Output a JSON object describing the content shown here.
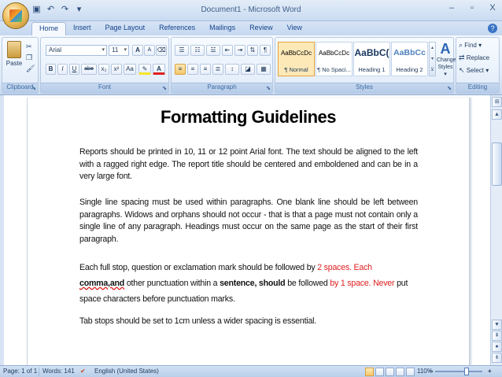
{
  "window": {
    "title": "Document1 - Microsoft Word",
    "controls": {
      "minimize": "–",
      "restore": "▫",
      "close": "X"
    }
  },
  "quick_access": [
    "save-icon",
    "undo-icon",
    "redo-icon",
    "customize-icon"
  ],
  "tabs": [
    "Home",
    "Insert",
    "Page Layout",
    "References",
    "Mailings",
    "Review",
    "View"
  ],
  "active_tab": "Home",
  "ribbon": {
    "clipboard": {
      "label": "Clipboard",
      "paste_label": "Paste"
    },
    "font": {
      "label": "Font",
      "font_name": "Arial",
      "font_size": "11",
      "bold": "B",
      "italic": "I",
      "underline": "U",
      "strike": "abe",
      "subscript": "x₂",
      "superscript": "x²",
      "change_case": "Aa",
      "grow": "A",
      "shrink": "A"
    },
    "paragraph": {
      "label": "Paragraph",
      "pilcrow": "¶"
    },
    "styles": {
      "label": "Styles",
      "items": [
        {
          "preview": "AaBbCcDc",
          "name": "¶ Normal"
        },
        {
          "preview": "AaBbCcDc",
          "name": "¶ No Spaci..."
        },
        {
          "preview": "AaBbC(",
          "name": "Heading 1"
        },
        {
          "preview": "AaBbCc",
          "name": "Heading 2"
        }
      ],
      "change_styles": "Change Styles ▾"
    },
    "editing": {
      "label": "Editing",
      "find": "Find ▾",
      "replace": "Replace",
      "select": "Select ▾"
    }
  },
  "document": {
    "title": "Formatting Guidelines",
    "p1": "Reports should be printed in 10, 11 or 12 point Arial font. The text should be aligned to the left with a ragged right edge. The report title should be centered and emboldened and can be in a very large font.",
    "p2": "Single line spacing must be used within paragraphs. One blank line should be left between paragraphs. Widows and orphans should not occur - that is that a page must not contain only a single line of any paragraph. Headings must occur on the same page as the start of their first paragraph.",
    "p3": {
      "a": "Each full stop, question or exclamation mark should be followed by ",
      "b": "2 spaces.  Each ",
      "c": "comma,and",
      "d": " other punctuation within a ",
      "e": "sentence, should",
      "f": " be followed ",
      "g": "by 1 space.  Never",
      "h": " put space characters before punctuation marks."
    },
    "p4": "Tab stops should be set to 1cm unless a wider spacing is essential."
  },
  "status": {
    "page": "Page: 1 of 1",
    "words": "Words: 141",
    "language": "English (United States)",
    "zoom": "110%",
    "zoom_minus": "–",
    "zoom_plus": "+"
  }
}
